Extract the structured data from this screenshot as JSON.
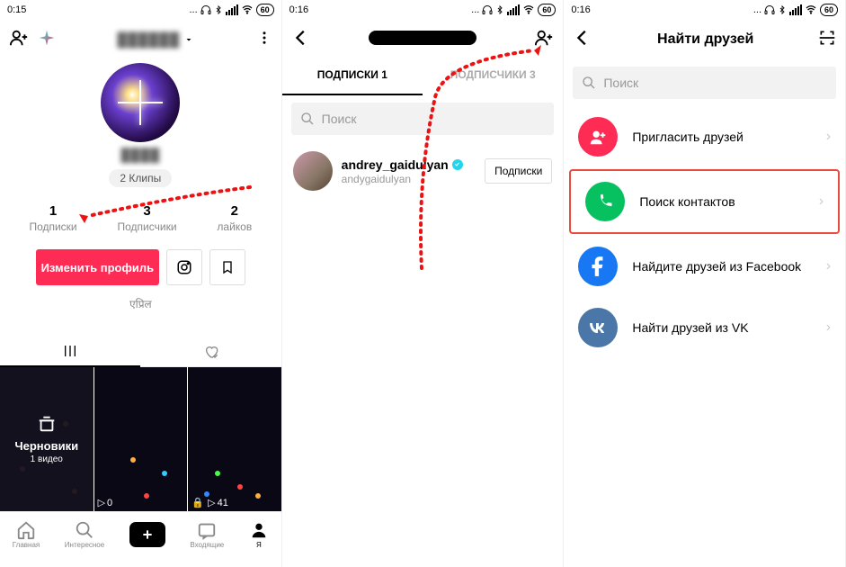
{
  "status": {
    "time1": "0:15",
    "time2": "0:16",
    "time3": "0:16",
    "dots": "...",
    "batt": "60"
  },
  "s1": {
    "username_masked": "██████",
    "at_masked": "████",
    "clips": "2 Клипы",
    "stats": [
      {
        "n": "1",
        "l": "Подписки"
      },
      {
        "n": "3",
        "l": "Подписчики"
      },
      {
        "n": "2",
        "l": "лайков"
      }
    ],
    "edit": "Изменить профиль",
    "hindi": "एप्रिल",
    "drafts_title": "Черновики",
    "drafts_sub": "1 видео",
    "plays": [
      "0",
      "",
      "41"
    ],
    "nav": [
      "Главная",
      "Интересное",
      "",
      "Входящие",
      "Я"
    ]
  },
  "s2": {
    "tabs": [
      "ПОДПИСКИ 1",
      "ПОДПИСЧИКИ 3"
    ],
    "search_ph": "Поиск",
    "user": {
      "name": "andrey_gaidulyan",
      "handle": "andygaidulyan"
    },
    "sub": "Подписки"
  },
  "s3": {
    "title": "Найти друзей",
    "search_ph": "Поиск",
    "options": [
      "Пригласить друзей",
      "Поиск контактов",
      "Найдите друзей из Facebook",
      "Найти друзей из VK"
    ]
  }
}
